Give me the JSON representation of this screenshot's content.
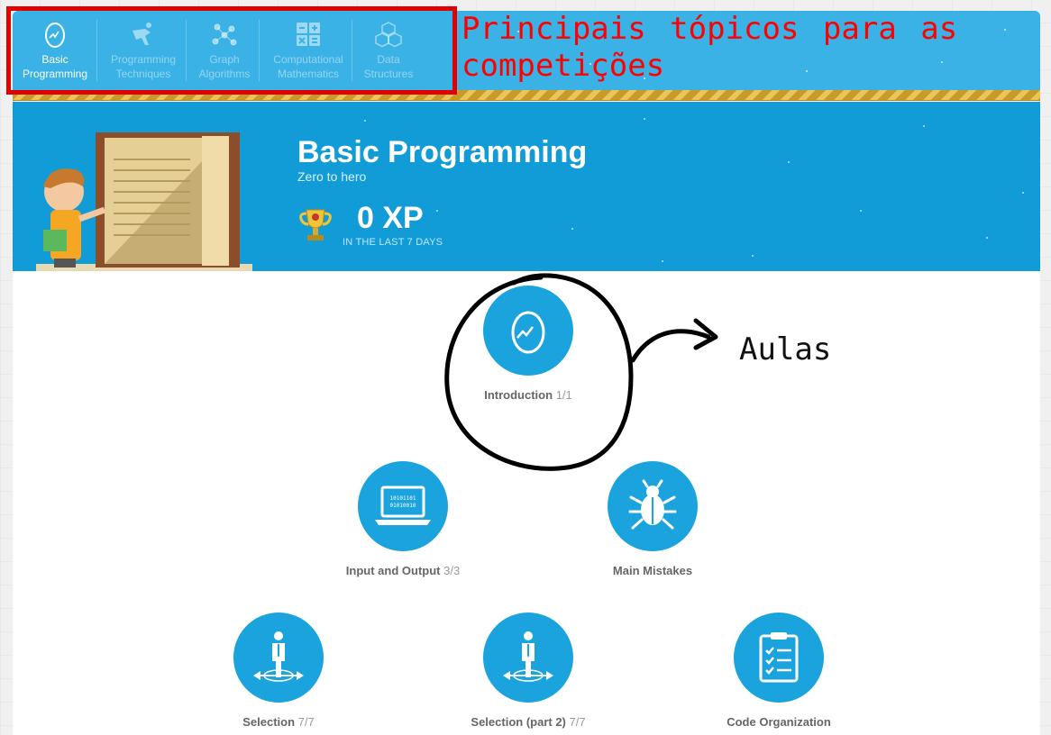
{
  "topic_nav": {
    "items": [
      {
        "label": "Basic Programming",
        "icon": "egg-icon",
        "active": true
      },
      {
        "label": "Programming Techniques",
        "icon": "kick-icon",
        "active": false
      },
      {
        "label": "Graph Algorithms",
        "icon": "graph-icon",
        "active": false
      },
      {
        "label": "Computational Mathematics",
        "icon": "calculator-icon",
        "active": false
      },
      {
        "label": "Data Structures",
        "icon": "cubes-icon",
        "active": false
      }
    ]
  },
  "hero": {
    "title": "Basic Programming",
    "subtitle": "Zero to hero",
    "xp_value": "0 XP",
    "xp_caption": "IN THE LAST 7 DAYS"
  },
  "lessons": [
    {
      "title": "Introduction",
      "progress": "1/1",
      "icon": "egg-icon"
    },
    {
      "title": "Input and Output",
      "progress": "3/3",
      "icon": "laptop-binary-icon"
    },
    {
      "title": "Main Mistakes",
      "progress": "",
      "icon": "bug-icon"
    },
    {
      "title": "Selection",
      "progress": "7/7",
      "icon": "person-crossroad-icon"
    },
    {
      "title": "Selection (part 2)",
      "progress": "7/7",
      "icon": "person-crossroad-icon"
    },
    {
      "title": "Code Organization",
      "progress": "",
      "icon": "clipboard-checklist-icon"
    }
  ],
  "annotations": {
    "topics_note": "Principais tópicos para as competições",
    "lessons_note": "Aulas"
  },
  "colors": {
    "nav_blue": "#3bb2e6",
    "hero_blue": "#119cd8",
    "lesson_blue": "#1aa3dd",
    "annotation_red": "#ff0000"
  }
}
